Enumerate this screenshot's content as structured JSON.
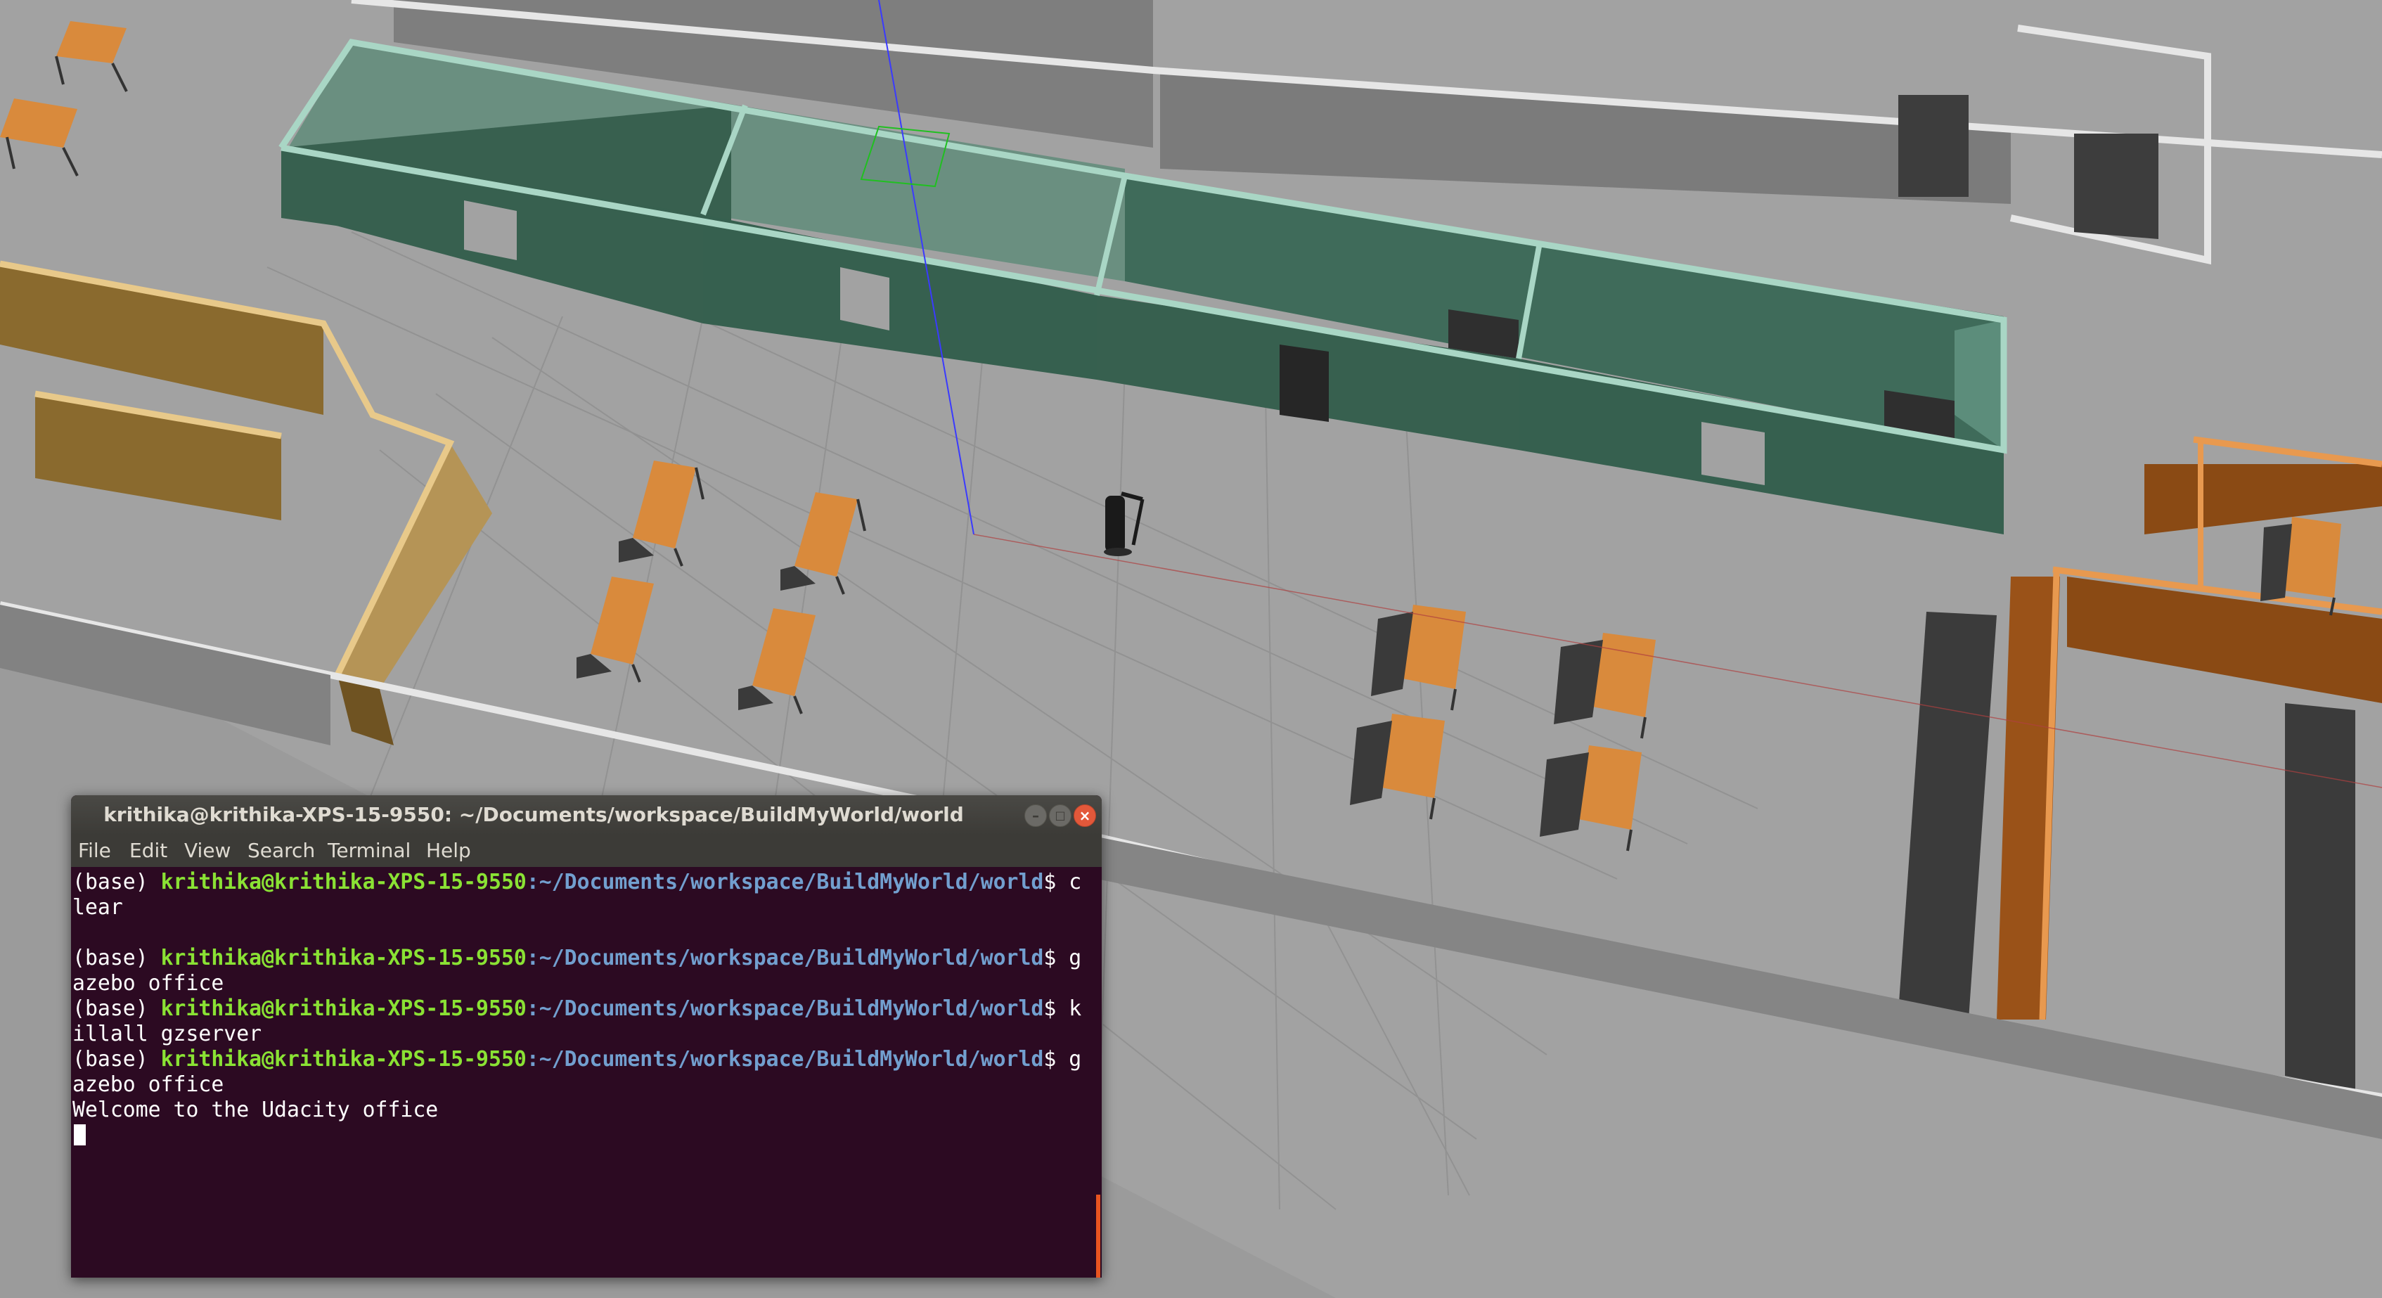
{
  "scene": {
    "name": "Gazebo 3D office world view",
    "colors": {
      "ground": "#9b9b9b",
      "floor_tile": "#a9a9a9",
      "teal_wall": "#37604f",
      "teal_top": "#a9d6c5",
      "tan_wall": "#8a6a2e",
      "tan_top": "#e8c98a",
      "orange_wall": "#8a4a14",
      "orange_top": "#e8994f",
      "table_top": "#d98a3c"
    }
  },
  "terminal": {
    "title": "krithika@krithika-XPS-15-9550: ~/Documents/workspace/BuildMyWorld/world",
    "menu": [
      "File",
      "Edit",
      "View",
      "Search",
      "Terminal",
      "Help"
    ],
    "prompt_base": "(base) ",
    "prompt_user": "krithika@krithika-XPS-15-9550",
    "prompt_path": ":~/Documents/workspace/BuildMyWorld/world",
    "prompt_dollar": "$",
    "lines": [
      {
        "cmd_start": " c",
        "cmd_rest": "lear"
      },
      {
        "cmd_start": " g",
        "cmd_rest": "azebo office"
      },
      {
        "cmd_start": " k",
        "cmd_rest": "illall gzserver"
      },
      {
        "cmd_start": " g",
        "cmd_rest": "azebo office"
      }
    ],
    "output": "Welcome to the Udacity office",
    "colors": {
      "background": "#2c0a22",
      "prompt_user": "#8ae234",
      "prompt_path": "#729fcf",
      "scroll_thumb": "#e95420"
    }
  }
}
